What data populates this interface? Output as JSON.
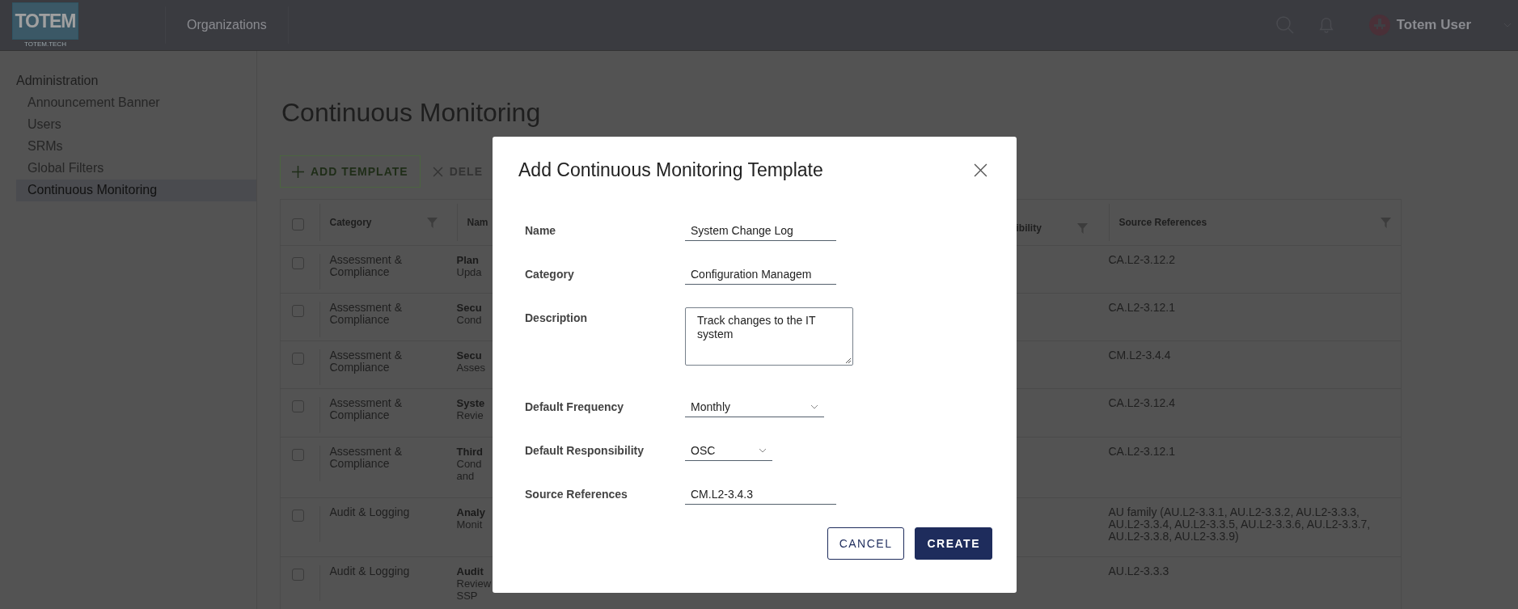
{
  "header": {
    "logo": "TOTEM",
    "logo_sub": "TOTEM.TECH",
    "nav": [
      {
        "label": "Organizations",
        "selected": false
      }
    ],
    "user": "Totem User"
  },
  "sidebar": {
    "title": "Administration",
    "items": [
      {
        "label": "Announcement Banner",
        "selected": false
      },
      {
        "label": "Users",
        "selected": false
      },
      {
        "label": "SRMs",
        "selected": false
      },
      {
        "label": "Global Filters",
        "selected": false
      },
      {
        "label": "Continuous Monitoring",
        "selected": true
      }
    ]
  },
  "page": {
    "title": "Continuous Monitoring",
    "actions": [
      {
        "label": "ADD TEMPLATE",
        "kind": "add",
        "disabled": false
      },
      {
        "label": "DELE",
        "kind": "delete",
        "disabled": true
      }
    ]
  },
  "table": {
    "all_checked": false,
    "columns": [
      {
        "label": "Category",
        "filter": true
      },
      {
        "label": "Nam",
        "filter": false
      },
      {
        "label": "ibility",
        "filter": true
      },
      {
        "label": "Source References",
        "filter": true
      }
    ],
    "rows": [
      {
        "checked": false,
        "category": "Assessment & Compliance",
        "name": "Plan",
        "description": [
          "Upda"
        ],
        "source": "CA.L2-3.12.2"
      },
      {
        "checked": false,
        "category": "Assessment & Compliance",
        "name": "Secu",
        "description": [
          "Cond"
        ],
        "source": "CA.L2-3.12.1"
      },
      {
        "checked": false,
        "category": "Assessment & Compliance",
        "name": "Secu",
        "description": [
          "Asses"
        ],
        "source": "CM.L2-3.4.4"
      },
      {
        "checked": false,
        "category": "Assessment & Compliance",
        "name": "Syste",
        "description": [
          "Revie"
        ],
        "source": "CA.L2-3.12.4"
      },
      {
        "checked": false,
        "category": "Assessment & Compliance",
        "name": "Third",
        "description": [
          "Cond",
          "and"
        ],
        "source": "CA.L2-3.12.1"
      },
      {
        "checked": false,
        "category": "Audit & Logging",
        "name": "Analy",
        "description": [
          "Monit"
        ],
        "source": "AU family (AU.L2-3.3.1, AU.L2-3.3.2, AU.L2-3.3.3, AU.L2-3.3.4, AU.L2-3.3.5, AU.L2-3.3.6, AU.L2-3.3.7, AU.L2-3.3.8, AU.L2-3.3.9)"
      },
      {
        "checked": false,
        "category": "Audit & Logging",
        "name": "Audit",
        "description": [
          "Review",
          "SSP"
        ],
        "source": "AU.L2-3.3.3"
      }
    ]
  },
  "dialog": {
    "title": "Add Continuous Monitoring Template",
    "fields": [
      {
        "label": "Name",
        "kind": "input",
        "value": "System Change Log"
      },
      {
        "label": "Category",
        "kind": "input",
        "value": "Configuration Managem"
      },
      {
        "label": "Description",
        "kind": "textarea",
        "value": "Track changes to the IT system"
      },
      {
        "label": "Default Frequency",
        "kind": "select",
        "value": "Monthly"
      },
      {
        "label": "Default Responsibility",
        "kind": "select",
        "value": "OSC"
      },
      {
        "label": "Source References",
        "kind": "input",
        "value": "CM.L2-3.4.3"
      }
    ],
    "buttons": [
      {
        "label": "CANCEL",
        "kind": "secondary"
      },
      {
        "label": "CREATE",
        "kind": "primary"
      }
    ]
  }
}
